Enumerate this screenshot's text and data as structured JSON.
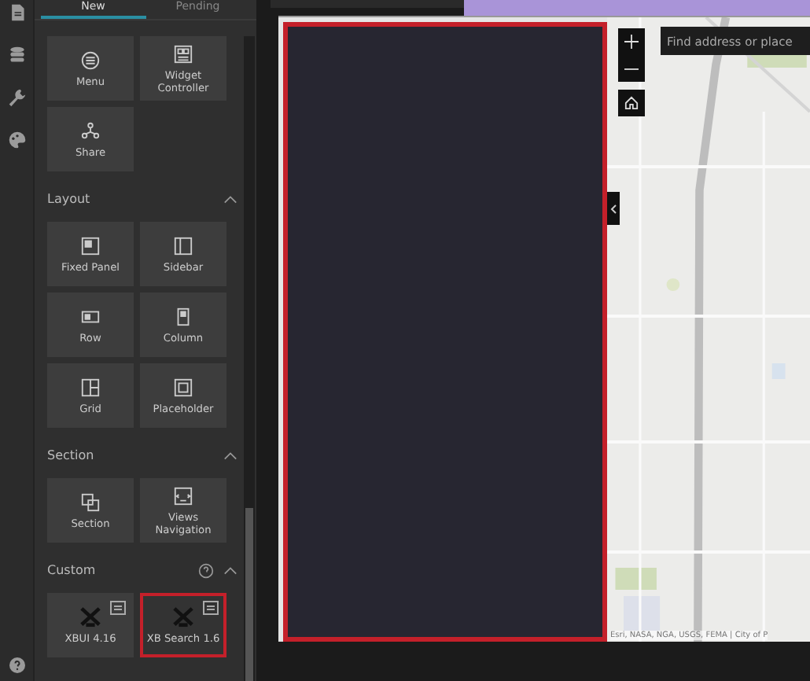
{
  "sidebar_icons": [
    {
      "kind": "page"
    },
    {
      "kind": "data"
    },
    {
      "kind": "wrench"
    },
    {
      "kind": "palette"
    }
  ],
  "tabs": [
    {
      "label": "New",
      "selected": true
    },
    {
      "label": "Pending",
      "selected": false
    }
  ],
  "groups": [
    {
      "widgets": [
        {
          "label": "Menu",
          "kind": "menu",
          "selected": false,
          "custom": false
        },
        {
          "label": "Widget Controller",
          "kind": "controller",
          "selected": false,
          "custom": false
        },
        {
          "label": "Share",
          "kind": "share",
          "selected": false,
          "custom": false
        }
      ]
    },
    {
      "title": "Layout",
      "expanded": true,
      "widgets": [
        {
          "label": "Fixed Panel",
          "kind": "fixed",
          "selected": false,
          "custom": false
        },
        {
          "label": "Sidebar",
          "kind": "sidebar",
          "selected": false,
          "custom": false
        },
        {
          "label": "Row",
          "kind": "row",
          "selected": false,
          "custom": false
        },
        {
          "label": "Column",
          "kind": "column",
          "selected": false,
          "custom": false
        },
        {
          "label": "Grid",
          "kind": "grid",
          "selected": false,
          "custom": false
        },
        {
          "label": "Placeholder",
          "kind": "placeholder",
          "selected": false,
          "custom": false
        }
      ]
    },
    {
      "title": "Section",
      "expanded": true,
      "widgets": [
        {
          "label": "Section",
          "kind": "section",
          "selected": false,
          "custom": false
        },
        {
          "label": "Views Navigation",
          "kind": "views",
          "selected": false,
          "custom": false
        }
      ]
    },
    {
      "title": "Custom",
      "expanded": true,
      "help": true,
      "widgets": [
        {
          "label": "XBUI 4.16",
          "kind": "x",
          "selected": false,
          "custom": true
        },
        {
          "label": "XB Search 1.6",
          "kind": "x",
          "selected": true,
          "custom": true
        }
      ]
    }
  ],
  "canvas": {
    "panel_selected": true,
    "search": {
      "placeholder": "Find address or place"
    },
    "attribution": "Esri, NASA, NGA, USGS, FEMA | City of P"
  }
}
